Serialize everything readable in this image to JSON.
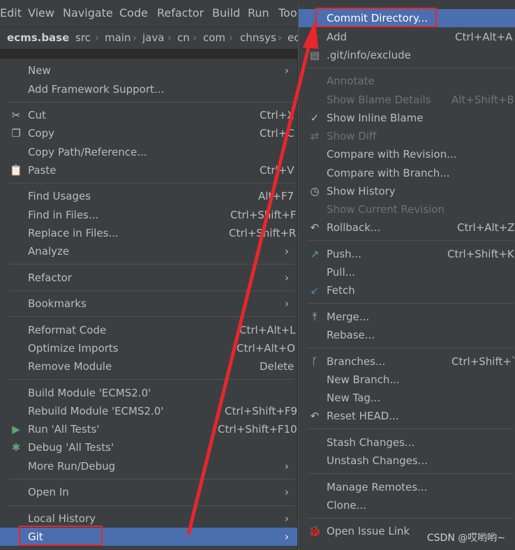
{
  "menubar": [
    "Edit",
    "View",
    "Navigate",
    "Code",
    "Refactor",
    "Build",
    "Run",
    "Too"
  ],
  "breadcrumb": [
    "ecms.base",
    "src",
    "main",
    "java",
    "cn",
    "com",
    "chnsys",
    "ec"
  ],
  "ctx": {
    "new": "New",
    "add_framework": "Add Framework Support...",
    "cut": "Cut",
    "cut_sc": "Ctrl+X",
    "copy": "Copy",
    "copy_sc": "Ctrl+C",
    "copy_path": "Copy Path/Reference...",
    "paste": "Paste",
    "paste_sc": "Ctrl+V",
    "find_usages": "Find Usages",
    "find_usages_sc": "Alt+F7",
    "find_in_files": "Find in Files...",
    "find_in_files_sc": "Ctrl+Shift+F",
    "replace_in_files": "Replace in Files...",
    "replace_in_files_sc": "Ctrl+Shift+R",
    "analyze": "Analyze",
    "refactor": "Refactor",
    "bookmarks": "Bookmarks",
    "reformat": "Reformat Code",
    "reformat_sc": "Ctrl+Alt+L",
    "optimize": "Optimize Imports",
    "optimize_sc": "Ctrl+Alt+O",
    "remove_module": "Remove Module",
    "remove_module_sc": "Delete",
    "build_module": "Build Module 'ECMS2.0'",
    "rebuild_module": "Rebuild Module 'ECMS2.0'",
    "rebuild_module_sc": "Ctrl+Shift+F9",
    "run_tests": "Run 'All Tests'",
    "run_tests_sc": "Ctrl+Shift+F10",
    "debug_tests": "Debug 'All Tests'",
    "more_run": "More Run/Debug",
    "open_in": "Open In",
    "local_history": "Local History",
    "git": "Git"
  },
  "git": {
    "commit_dir": "Commit Directory...",
    "add": "Add",
    "add_sc": "Ctrl+Alt+A",
    "exclude": ".git/info/exclude",
    "annotate": "Annotate",
    "blame_details": "Show Blame Details",
    "blame_details_sc": "Alt+Shift+B",
    "inline_blame": "Show Inline Blame",
    "show_diff": "Show Diff",
    "compare_revision": "Compare with Revision...",
    "compare_branch": "Compare with Branch...",
    "show_history": "Show History",
    "current_revision": "Show Current Revision",
    "rollback": "Rollback...",
    "rollback_sc": "Ctrl+Alt+Z",
    "push": "Push...",
    "push_sc": "Ctrl+Shift+K",
    "pull": "Pull...",
    "fetch": "Fetch",
    "merge": "Merge...",
    "rebase": "Rebase...",
    "branches": "Branches...",
    "branches_sc": "Ctrl+Shift+`",
    "new_branch": "New Branch...",
    "new_tag": "New Tag...",
    "reset_head": "Reset HEAD...",
    "stash": "Stash Changes...",
    "unstash": "Unstash Changes...",
    "manage_remotes": "Manage Remotes...",
    "clone": "Clone...",
    "open_issue": "Open Issue Link"
  },
  "watermark": "CSDN @哎哟哟~",
  "colors": {
    "selection": "#4b6eaf",
    "highlight_box": "#e8262d",
    "arrow": "#e8262d"
  }
}
